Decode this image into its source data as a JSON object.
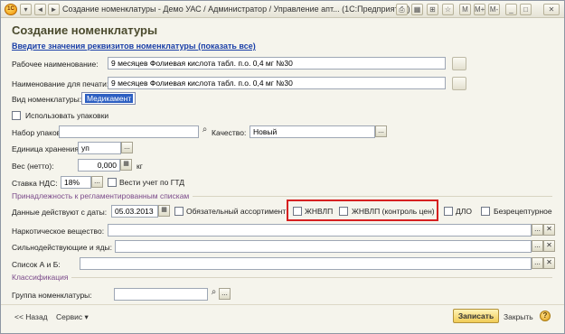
{
  "window": {
    "logo_text": "1С",
    "title": "Создание номенклатуры - Демо УАС / Администратор / Управление апт...",
    "app_suffix": "(1С:Предприятие)",
    "title_buttons": [
      "◄",
      "►"
    ],
    "icons": [
      "app-logo-icon",
      "dropdown-icon",
      "back-icon",
      "forward-icon",
      "print-icon",
      "calendar-icon",
      "calc-icon",
      "star-icon",
      "minimize-icon",
      "maximize-icon",
      "close-icon"
    ]
  },
  "form": {
    "title": "Создание номенклатуры",
    "requisites_link": "Введите значения реквизитов номенклатуры (показать все)",
    "working_name_label": "Рабочее наименование:",
    "working_name_value": "9 месяцев Фолиевая кислота табл. п.о. 0,4 мг №30",
    "print_name_label": "Наименование для печати:",
    "print_name_value": "9 месяцев Фолиевая кислота табл. п.о. 0,4 мг №30",
    "kind_label": "Вид номенклатуры:",
    "kind_value": "Медикамент",
    "use_packages_label": "Использовать упаковки",
    "package_set_label": "Набор упаковок:",
    "package_set_value": "",
    "quality_label": "Качество:",
    "quality_value": "Новый",
    "storage_unit_label": "Единица хранения:",
    "storage_unit_value": "уп",
    "weight_label": "Вес (нетто):",
    "weight_value": "0,000",
    "weight_unit": "кг",
    "vat_label": "Ставка НДС:",
    "vat_value": "18%",
    "gtd_label": "Вести учет по ГТД",
    "section_lists": "Принадлежность к регламентированным спискам",
    "valid_from_label": "Данные действуют с даты:",
    "valid_from_value": "05.03.2013",
    "mandatory_assort_label": "Обязательный ассортимент",
    "zhnvlp_label": "ЖНВЛП",
    "zhnvlp_control_label": "ЖНВЛП (контроль цен)",
    "dlo_label": "ДЛО",
    "nonprescription_label": "Безрецептурное",
    "narcotic_label": "Наркотическое вещество:",
    "narcotic_value": "",
    "potent_label": "Сильнодействующие и яды:",
    "potent_value": "",
    "list_ab_label": "Список А и Б:",
    "list_ab_value": "",
    "section_class": "Классификация",
    "group_label": "Группа номенклатуры:",
    "group_value": ""
  },
  "footer": {
    "back_label": "<< Назад",
    "service_label": "Сервис ▾",
    "save_label": "Записать",
    "close_label": "Закрыть",
    "help_label": "?"
  },
  "colors": {
    "accent_red": "#d62020",
    "title_color": "#4b4b2e",
    "link_color": "#1a3fa8",
    "section_color": "#7b4a8a",
    "primary_button": "#f1cc55"
  }
}
